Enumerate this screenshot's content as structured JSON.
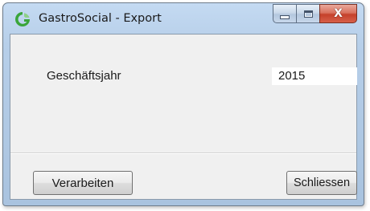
{
  "window": {
    "title": "GastroSocial - Export",
    "app_icon": "gastrosocial-logo-icon",
    "caption_buttons": {
      "minimize": "minimize-icon",
      "maximize": "maximize-icon",
      "close": "close-icon",
      "close_glyph": "X"
    }
  },
  "form": {
    "fiscal_year_label": "Geschäftsjahr",
    "fiscal_year_value": "2015"
  },
  "actions": {
    "process_label": "Verarbeiten",
    "close_label": "Schliessen"
  },
  "colors": {
    "titlebar": "#b7cfe9",
    "client_background": "#f0f0f0",
    "close_button": "#c5412b",
    "logo_green": "#3aa53a"
  }
}
